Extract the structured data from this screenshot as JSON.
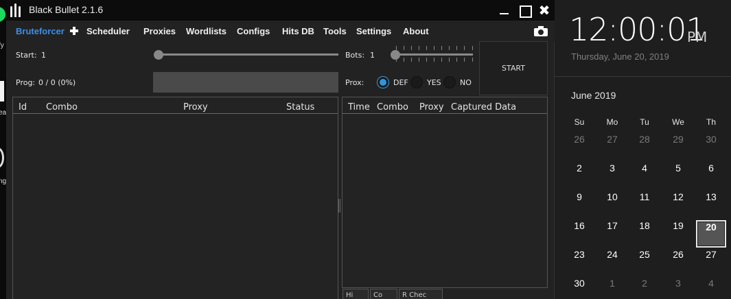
{
  "window": {
    "title": "Black Bullet 2.1.6"
  },
  "menu": [
    {
      "label": "Bruteforcer",
      "active": true
    },
    {
      "label": "Scheduler"
    },
    {
      "label": "Proxies"
    },
    {
      "label": "Wordlists"
    },
    {
      "label": "Configs"
    },
    {
      "label": "Hits DB"
    },
    {
      "label": "Tools"
    },
    {
      "label": "Settings"
    },
    {
      "label": "About"
    }
  ],
  "controls": {
    "start_label": "Start:",
    "start_value": "1",
    "bots_label": "Bots:",
    "bots_value": "1",
    "prog_label": "Prog:",
    "prog_value": "0 / 0 (0%)",
    "prox_label": "Prox:",
    "prox_options": [
      {
        "label": "DEF",
        "selected": true
      },
      {
        "label": "YES",
        "selected": false
      },
      {
        "label": "NO",
        "selected": false
      }
    ],
    "start_button": "START",
    "progress": 0
  },
  "left_grid": {
    "columns": [
      "Id",
      "Combo",
      "Proxy",
      "Status"
    ]
  },
  "right_grid": {
    "columns": [
      "Time",
      "Combo",
      "Proxy",
      "Captured Data"
    ]
  },
  "bottom_tabs": [
    "Hi",
    "Co",
    "R Chec"
  ],
  "desktop": {
    "labels": [
      "fy",
      "ea",
      "ng"
    ]
  },
  "clock": {
    "time": "12:00:01",
    "ampm": "PM",
    "date": "Thursday, June 20, 2019",
    "month": "June 2019",
    "weekdays": [
      "Su",
      "Mo",
      "Tu",
      "We",
      "Th"
    ],
    "weeks": [
      [
        "26",
        "27",
        "28",
        "29",
        "30"
      ],
      [
        "2",
        "3",
        "4",
        "5",
        "6"
      ],
      [
        "9",
        "10",
        "11",
        "12",
        "13"
      ],
      [
        "16",
        "17",
        "18",
        "19",
        "20"
      ],
      [
        "23",
        "24",
        "25",
        "26",
        "27"
      ],
      [
        "30",
        "1",
        "2",
        "3",
        "4"
      ]
    ],
    "dim_cells": [
      "0-0",
      "0-1",
      "0-2",
      "0-3",
      "0-4",
      "5-1",
      "5-2",
      "5-3",
      "5-4"
    ],
    "today_cell": "3-4"
  },
  "colors": {
    "accent": "#3c8fe6",
    "radio_on": "#2e95e0"
  }
}
